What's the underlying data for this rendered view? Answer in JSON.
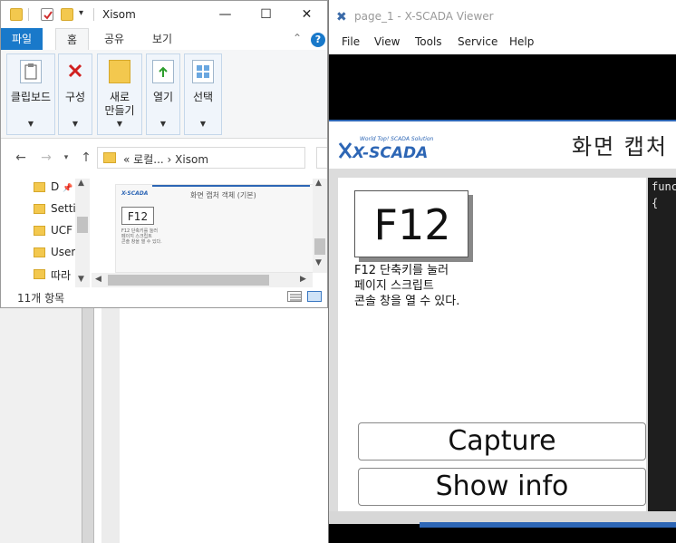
{
  "explorer": {
    "title": "Xisom",
    "window_buttons": [
      "—",
      "☐",
      "✕"
    ],
    "tabs": [
      {
        "label": "파일"
      },
      {
        "label": "홈"
      },
      {
        "label": "공유"
      },
      {
        "label": "보기"
      }
    ],
    "collapse_glyph": "⌃",
    "help_label": "?",
    "ribbon_groups": [
      {
        "label": "클립보드"
      },
      {
        "label": "구성"
      },
      {
        "label": "새로\n만들기"
      },
      {
        "label": "열기"
      },
      {
        "label": "선택"
      }
    ],
    "address": {
      "prefix": "«",
      "parent": "로컬...",
      "separator": "›",
      "current": "Xisom",
      "refresh_glyph": "↻"
    },
    "nav_items": [
      {
        "label": "D"
      },
      {
        "label": "Setti"
      },
      {
        "label": "UCF"
      },
      {
        "label": "Users"
      },
      {
        "label": "따라"
      }
    ],
    "thumbnail": {
      "heading": "화면 캡처 객체 (기본)",
      "key": "F12"
    },
    "status_text": "11개 항목"
  },
  "viewer": {
    "title": "page_1 - X-SCADA Viewer",
    "menu": [
      {
        "label": "File"
      },
      {
        "label": "View"
      },
      {
        "label": "Tools"
      },
      {
        "label": "Service"
      },
      {
        "label": "Help"
      }
    ],
    "logo": {
      "tagline": "World Top! SCADA Solution",
      "name": "X-SCADA"
    },
    "page_heading": "화면 캡처",
    "key_label": "F12",
    "description": "F12 단축키를 눌러\n페이지 스크립트\n콘솔 창을 열 수 있다.",
    "capture_button": "Capture",
    "showinfo_button": "Show info",
    "code_lines": [
      "func",
      "{"
    ]
  },
  "colors": {
    "accent": "#1979ca",
    "scada_blue": "#2d66b5",
    "folder": "#f3c84e"
  }
}
